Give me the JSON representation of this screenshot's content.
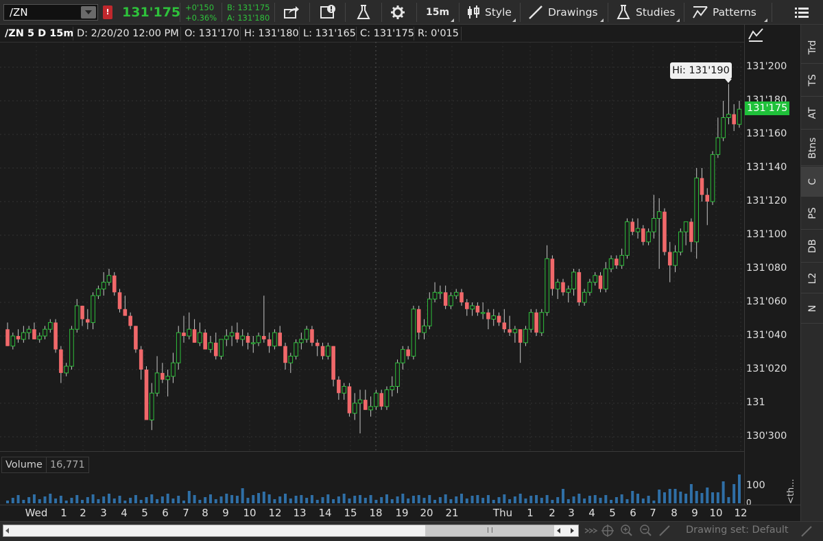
{
  "toolbar": {
    "symbol": "/ZN",
    "alert_flag": "!",
    "last_price": "131'175",
    "net_change": "+0'150",
    "pct_change": "+0.36%",
    "bid": "B: 131'175",
    "ask": "A: 131'180",
    "timeframe": "15m",
    "style_label": "Style",
    "drawings_label": "Drawings",
    "studies_label": "Studies",
    "patterns_label": "Patterns"
  },
  "info_bar": {
    "title": "/ZN 5 D 15m",
    "date": "D: 2/20/20 12:00 PM",
    "open": "O: 131'170",
    "high": "H: 131'180",
    "low": "L: 131'165",
    "close": "C: 131'175",
    "range": "R: 0'015"
  },
  "price_axis": {
    "labels": [
      "131'200",
      "131'180",
      "131'160",
      "131'140",
      "131'120",
      "131'100",
      "131'080",
      "131'060",
      "131'040",
      "131'020",
      "131",
      "130'300"
    ],
    "current_price": "131'175",
    "hi_bubble": "Hi: 131'190"
  },
  "sidebar_tabs": [
    "Trd",
    "TS",
    "AT",
    "Btns",
    "C",
    "PS",
    "DB",
    "L2",
    "N"
  ],
  "sidebar_active": "C",
  "volume": {
    "label": "Volume",
    "value": "16,771",
    "axis_label": "100",
    "axis_label_2": "0",
    "axis_side_text": "<th..."
  },
  "time_axis": {
    "labels": [
      "Wed",
      "1",
      "2",
      "3",
      "4",
      "5",
      "6",
      "7",
      "8",
      "9",
      "10",
      "12",
      "13",
      "14",
      "15",
      "18",
      "19",
      "20",
      "21",
      "Thu",
      "1",
      "2",
      "3",
      "4",
      "5",
      "6",
      "7",
      "8",
      "9",
      "10",
      "12"
    ]
  },
  "bottom_bar": {
    "drawing_set": "Drawing set: Default"
  },
  "colors": {
    "up": "#2ec13b",
    "down": "#f0686a",
    "volume": "#2f6fa6",
    "background": "#1b1b1b"
  },
  "chart_data": {
    "type": "candlestick",
    "symbol": "/ZN",
    "interval": "15m",
    "ylim_ticks_32nds": [
      -2,
      22
    ],
    "y_unit": "32nds above 131 (131'200 = +20)",
    "candles": [
      {
        "o": 4.4,
        "h": 4.8,
        "l": 3.4,
        "c": 3.4
      },
      {
        "o": 3.4,
        "h": 4.2,
        "l": 3.2,
        "c": 4.0
      },
      {
        "o": 4.0,
        "h": 4.4,
        "l": 3.6,
        "c": 3.8
      },
      {
        "o": 3.8,
        "h": 4.6,
        "l": 3.6,
        "c": 4.2
      },
      {
        "o": 4.2,
        "h": 4.6,
        "l": 3.8,
        "c": 4.4
      },
      {
        "o": 4.4,
        "h": 4.8,
        "l": 3.8,
        "c": 3.8
      },
      {
        "o": 3.8,
        "h": 4.2,
        "l": 3.6,
        "c": 4.0
      },
      {
        "o": 4.0,
        "h": 4.6,
        "l": 3.8,
        "c": 4.4
      },
      {
        "o": 4.4,
        "h": 5.0,
        "l": 4.2,
        "c": 4.8
      },
      {
        "o": 4.8,
        "h": 5.0,
        "l": 3.0,
        "c": 3.2
      },
      {
        "o": 3.2,
        "h": 3.4,
        "l": 1.2,
        "c": 1.8
      },
      {
        "o": 1.8,
        "h": 2.4,
        "l": 1.6,
        "c": 2.2
      },
      {
        "o": 2.2,
        "h": 4.6,
        "l": 2.0,
        "c": 4.4
      },
      {
        "o": 4.4,
        "h": 6.2,
        "l": 4.2,
        "c": 5.8
      },
      {
        "o": 5.8,
        "h": 5.8,
        "l": 4.6,
        "c": 5.0
      },
      {
        "o": 5.0,
        "h": 5.6,
        "l": 4.4,
        "c": 4.8
      },
      {
        "o": 4.8,
        "h": 6.6,
        "l": 4.4,
        "c": 6.4
      },
      {
        "o": 6.4,
        "h": 7.0,
        "l": 6.2,
        "c": 6.8
      },
      {
        "o": 6.8,
        "h": 7.8,
        "l": 6.4,
        "c": 7.2
      },
      {
        "o": 7.2,
        "h": 8.0,
        "l": 7.0,
        "c": 7.6
      },
      {
        "o": 7.6,
        "h": 7.8,
        "l": 6.4,
        "c": 6.6
      },
      {
        "o": 6.6,
        "h": 6.8,
        "l": 5.4,
        "c": 5.6
      },
      {
        "o": 5.6,
        "h": 6.4,
        "l": 5.2,
        "c": 5.2
      },
      {
        "o": 5.2,
        "h": 5.4,
        "l": 4.4,
        "c": 4.6
      },
      {
        "o": 4.6,
        "h": 4.6,
        "l": 3.0,
        "c": 3.2
      },
      {
        "o": 3.2,
        "h": 3.4,
        "l": 1.4,
        "c": 2.0
      },
      {
        "o": 2.0,
        "h": 2.2,
        "l": -1.0,
        "c": -1.0
      },
      {
        "o": -1.0,
        "h": 1.2,
        "l": -1.6,
        "c": 0.6
      },
      {
        "o": 0.6,
        "h": 2.8,
        "l": 0.4,
        "c": 1.8
      },
      {
        "o": 1.8,
        "h": 2.4,
        "l": 1.2,
        "c": 1.4
      },
      {
        "o": 1.4,
        "h": 2.0,
        "l": 0.4,
        "c": 1.6
      },
      {
        "o": 1.6,
        "h": 3.0,
        "l": 1.2,
        "c": 2.4
      },
      {
        "o": 2.4,
        "h": 4.6,
        "l": 2.0,
        "c": 4.2
      },
      {
        "o": 4.2,
        "h": 5.2,
        "l": 3.6,
        "c": 4.0
      },
      {
        "o": 4.0,
        "h": 5.4,
        "l": 3.8,
        "c": 4.4
      },
      {
        "o": 4.4,
        "h": 5.0,
        "l": 3.6,
        "c": 3.6
      },
      {
        "o": 3.6,
        "h": 4.8,
        "l": 3.4,
        "c": 4.2
      },
      {
        "o": 4.2,
        "h": 4.4,
        "l": 3.2,
        "c": 3.2
      },
      {
        "o": 3.2,
        "h": 4.0,
        "l": 3.0,
        "c": 3.6
      },
      {
        "o": 3.6,
        "h": 4.2,
        "l": 2.6,
        "c": 2.8
      },
      {
        "o": 2.8,
        "h": 3.8,
        "l": 2.6,
        "c": 3.8
      },
      {
        "o": 3.8,
        "h": 4.4,
        "l": 3.4,
        "c": 4.0
      },
      {
        "o": 4.0,
        "h": 4.6,
        "l": 3.4,
        "c": 4.2
      },
      {
        "o": 4.2,
        "h": 4.8,
        "l": 3.6,
        "c": 3.8
      },
      {
        "o": 3.8,
        "h": 4.4,
        "l": 3.4,
        "c": 4.0
      },
      {
        "o": 4.0,
        "h": 4.2,
        "l": 3.2,
        "c": 3.6
      },
      {
        "o": 3.6,
        "h": 4.0,
        "l": 3.0,
        "c": 3.6
      },
      {
        "o": 3.6,
        "h": 4.2,
        "l": 3.4,
        "c": 4.0
      },
      {
        "o": 4.0,
        "h": 6.4,
        "l": 3.6,
        "c": 3.8
      },
      {
        "o": 3.8,
        "h": 4.2,
        "l": 3.0,
        "c": 3.4
      },
      {
        "o": 3.4,
        "h": 4.4,
        "l": 3.2,
        "c": 4.2
      },
      {
        "o": 4.2,
        "h": 4.6,
        "l": 3.4,
        "c": 3.4
      },
      {
        "o": 3.4,
        "h": 3.6,
        "l": 2.0,
        "c": 2.4
      },
      {
        "o": 2.4,
        "h": 3.0,
        "l": 1.8,
        "c": 2.8
      },
      {
        "o": 2.8,
        "h": 3.8,
        "l": 2.6,
        "c": 3.6
      },
      {
        "o": 3.6,
        "h": 4.2,
        "l": 3.2,
        "c": 3.8
      },
      {
        "o": 3.8,
        "h": 4.6,
        "l": 3.6,
        "c": 4.4
      },
      {
        "o": 4.4,
        "h": 4.6,
        "l": 3.4,
        "c": 3.6
      },
      {
        "o": 3.6,
        "h": 3.8,
        "l": 2.8,
        "c": 3.4
      },
      {
        "o": 3.4,
        "h": 3.6,
        "l": 2.6,
        "c": 2.8
      },
      {
        "o": 2.8,
        "h": 3.6,
        "l": 2.6,
        "c": 3.4
      },
      {
        "o": 3.4,
        "h": 3.4,
        "l": 1.0,
        "c": 1.4
      },
      {
        "o": 1.4,
        "h": 1.6,
        "l": 0.2,
        "c": 0.6
      },
      {
        "o": 0.6,
        "h": 1.2,
        "l": 0.2,
        "c": 1.0
      },
      {
        "o": 1.0,
        "h": 1.2,
        "l": -0.8,
        "c": -0.6
      },
      {
        "o": -0.6,
        "h": 0.6,
        "l": -1.0,
        "c": 0.0
      },
      {
        "o": 0.0,
        "h": 0.8,
        "l": -1.8,
        "c": 0.2
      },
      {
        "o": 0.2,
        "h": 0.8,
        "l": -0.4,
        "c": -0.4
      },
      {
        "o": -0.4,
        "h": 0.4,
        "l": -0.8,
        "c": -0.2
      },
      {
        "o": -0.2,
        "h": 0.8,
        "l": -0.4,
        "c": 0.6
      },
      {
        "o": 0.6,
        "h": 0.8,
        "l": -0.4,
        "c": -0.2
      },
      {
        "o": -0.2,
        "h": 1.0,
        "l": -0.4,
        "c": 0.8
      },
      {
        "o": 0.8,
        "h": 1.6,
        "l": 0.4,
        "c": 1.0
      },
      {
        "o": 1.0,
        "h": 2.6,
        "l": 0.6,
        "c": 2.4
      },
      {
        "o": 2.4,
        "h": 3.4,
        "l": 2.0,
        "c": 3.2
      },
      {
        "o": 3.2,
        "h": 3.4,
        "l": 2.6,
        "c": 2.8
      },
      {
        "o": 2.8,
        "h": 5.8,
        "l": 2.6,
        "c": 5.6
      },
      {
        "o": 5.6,
        "h": 5.8,
        "l": 3.8,
        "c": 4.2
      },
      {
        "o": 4.2,
        "h": 5.0,
        "l": 3.8,
        "c": 4.6
      },
      {
        "o": 4.6,
        "h": 6.6,
        "l": 4.4,
        "c": 6.2
      },
      {
        "o": 6.2,
        "h": 7.2,
        "l": 6.0,
        "c": 6.6
      },
      {
        "o": 6.6,
        "h": 7.0,
        "l": 6.2,
        "c": 6.6
      },
      {
        "o": 6.6,
        "h": 7.0,
        "l": 5.6,
        "c": 5.8
      },
      {
        "o": 5.8,
        "h": 6.6,
        "l": 5.6,
        "c": 6.4
      },
      {
        "o": 6.4,
        "h": 6.8,
        "l": 6.2,
        "c": 6.6
      },
      {
        "o": 6.6,
        "h": 6.8,
        "l": 5.8,
        "c": 6.0
      },
      {
        "o": 6.0,
        "h": 6.2,
        "l": 5.2,
        "c": 5.6
      },
      {
        "o": 5.6,
        "h": 6.0,
        "l": 5.2,
        "c": 5.8
      },
      {
        "o": 5.8,
        "h": 6.0,
        "l": 5.2,
        "c": 5.4
      },
      {
        "o": 5.4,
        "h": 6.0,
        "l": 5.0,
        "c": 5.4
      },
      {
        "o": 5.4,
        "h": 5.6,
        "l": 4.4,
        "c": 5.0
      },
      {
        "o": 5.0,
        "h": 5.6,
        "l": 4.6,
        "c": 5.2
      },
      {
        "o": 5.2,
        "h": 5.4,
        "l": 4.6,
        "c": 4.8
      },
      {
        "o": 4.8,
        "h": 5.6,
        "l": 4.2,
        "c": 4.4
      },
      {
        "o": 4.4,
        "h": 5.2,
        "l": 4.0,
        "c": 4.2
      },
      {
        "o": 4.2,
        "h": 4.6,
        "l": 3.6,
        "c": 4.4
      },
      {
        "o": 4.4,
        "h": 4.4,
        "l": 2.4,
        "c": 3.6
      },
      {
        "o": 3.6,
        "h": 4.6,
        "l": 3.4,
        "c": 4.4
      },
      {
        "o": 4.4,
        "h": 5.6,
        "l": 4.2,
        "c": 5.4
      },
      {
        "o": 5.4,
        "h": 5.6,
        "l": 4.0,
        "c": 4.2
      },
      {
        "o": 4.2,
        "h": 5.6,
        "l": 4.0,
        "c": 5.4
      },
      {
        "o": 5.4,
        "h": 9.4,
        "l": 5.2,
        "c": 8.6
      },
      {
        "o": 8.6,
        "h": 8.8,
        "l": 6.4,
        "c": 6.8
      },
      {
        "o": 6.8,
        "h": 7.4,
        "l": 6.2,
        "c": 7.2
      },
      {
        "o": 7.2,
        "h": 7.4,
        "l": 6.4,
        "c": 6.6
      },
      {
        "o": 6.6,
        "h": 7.0,
        "l": 6.0,
        "c": 6.8
      },
      {
        "o": 6.8,
        "h": 8.0,
        "l": 6.4,
        "c": 7.8
      },
      {
        "o": 7.8,
        "h": 8.0,
        "l": 5.8,
        "c": 6.0
      },
      {
        "o": 6.0,
        "h": 6.8,
        "l": 5.8,
        "c": 6.6
      },
      {
        "o": 6.6,
        "h": 7.4,
        "l": 6.4,
        "c": 7.2
      },
      {
        "o": 7.2,
        "h": 7.8,
        "l": 7.0,
        "c": 7.6
      },
      {
        "o": 7.6,
        "h": 7.8,
        "l": 6.6,
        "c": 6.8
      },
      {
        "o": 6.8,
        "h": 8.4,
        "l": 6.6,
        "c": 8.0
      },
      {
        "o": 8.0,
        "h": 8.8,
        "l": 7.8,
        "c": 8.6
      },
      {
        "o": 8.6,
        "h": 8.8,
        "l": 8.0,
        "c": 8.2
      },
      {
        "o": 8.2,
        "h": 9.2,
        "l": 8.0,
        "c": 8.8
      },
      {
        "o": 8.8,
        "h": 11.0,
        "l": 8.6,
        "c": 10.8
      },
      {
        "o": 10.8,
        "h": 11.0,
        "l": 10.0,
        "c": 10.2
      },
      {
        "o": 10.2,
        "h": 11.0,
        "l": 9.8,
        "c": 10.4
      },
      {
        "o": 10.4,
        "h": 10.6,
        "l": 9.4,
        "c": 9.6
      },
      {
        "o": 9.6,
        "h": 10.4,
        "l": 9.4,
        "c": 10.2
      },
      {
        "o": 10.2,
        "h": 12.4,
        "l": 9.8,
        "c": 11.0
      },
      {
        "o": 11.0,
        "h": 12.2,
        "l": 8.0,
        "c": 11.4
      },
      {
        "o": 11.4,
        "h": 11.6,
        "l": 8.8,
        "c": 9.0
      },
      {
        "o": 9.0,
        "h": 9.6,
        "l": 7.2,
        "c": 8.2
      },
      {
        "o": 8.2,
        "h": 9.4,
        "l": 7.8,
        "c": 9.0
      },
      {
        "o": 9.0,
        "h": 10.4,
        "l": 8.8,
        "c": 10.2
      },
      {
        "o": 10.2,
        "h": 10.8,
        "l": 9.4,
        "c": 10.8
      },
      {
        "o": 10.8,
        "h": 11.0,
        "l": 9.0,
        "c": 9.6
      },
      {
        "o": 9.6,
        "h": 14.0,
        "l": 8.6,
        "c": 13.4
      },
      {
        "o": 13.4,
        "h": 14.0,
        "l": 12.0,
        "c": 12.4
      },
      {
        "o": 12.4,
        "h": 12.8,
        "l": 10.6,
        "c": 12.0
      },
      {
        "o": 12.0,
        "h": 15.0,
        "l": 11.8,
        "c": 14.8
      },
      {
        "o": 14.8,
        "h": 17.0,
        "l": 14.6,
        "c": 15.8
      },
      {
        "o": 15.8,
        "h": 18.0,
        "l": 15.6,
        "c": 17.0
      },
      {
        "o": 17.0,
        "h": 19.0,
        "l": 16.6,
        "c": 17.2
      },
      {
        "o": 17.2,
        "h": 17.8,
        "l": 16.2,
        "c": 16.6
      },
      {
        "o": 16.6,
        "h": 18.0,
        "l": 16.4,
        "c": 17.5
      }
    ],
    "volume_axis": [
      0,
      100
    ]
  }
}
